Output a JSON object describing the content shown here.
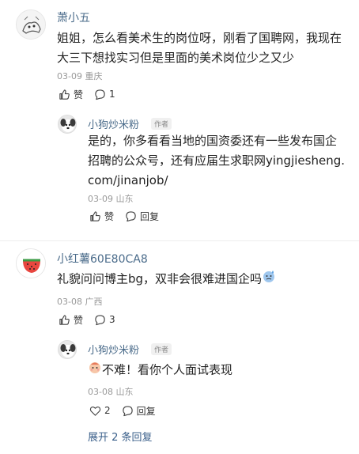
{
  "comments": [
    {
      "name": "萧小五",
      "text_lines": [
        "姐姐，怎么看美术生的岗位呀，刚看了国聘网，我现在",
        "大三下想找实习但是里面的美术岗位少之又少"
      ],
      "meta": "03-09 重庆",
      "like_label": "赞",
      "reply_count": "1",
      "reply": {
        "name": "小狗炒米粉",
        "tag": "作者",
        "text_lines": [
          "是的，你多看看当地的国资委还有一些发布国企",
          "招聘的公众号，还有应届生求职网yingjiesheng.",
          "com/jinanjob/"
        ],
        "meta": "03-09 山东",
        "like_label": "赞",
        "reply_label": "回复"
      }
    },
    {
      "name": "小红薯60E80CA8",
      "text": "礼貌问问博主bg，双非会很难进国企吗",
      "meta": "03-08 广西",
      "like_label": "赞",
      "reply_count": "3",
      "reply": {
        "name": "小狗炒米粉",
        "tag": "作者",
        "text": "不难！看你个人面试表现",
        "meta": "03-08 山东",
        "like_count": "2",
        "reply_label": "回复"
      }
    }
  ],
  "expand_label": "展开 2 条回复"
}
